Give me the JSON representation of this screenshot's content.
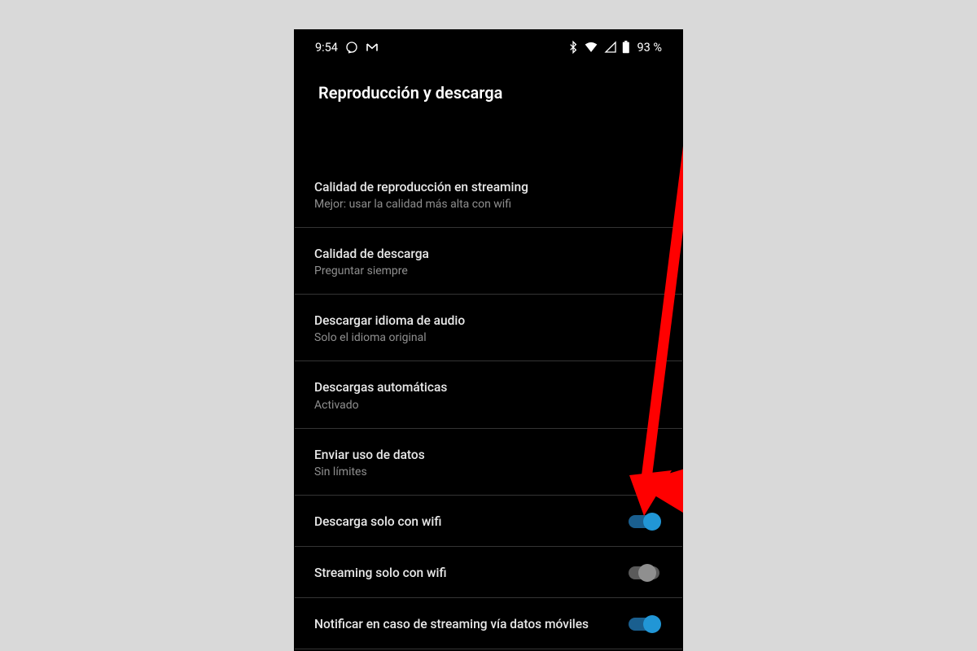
{
  "status": {
    "time": "9:54",
    "battery": "93 %",
    "icons_left": [
      "whatsapp-icon",
      "gmail-icon"
    ],
    "icons_right": [
      "bluetooth-icon",
      "wifi-icon",
      "cell-icon",
      "battery-icon"
    ]
  },
  "page": {
    "title": "Reproducción y descarga"
  },
  "settings": [
    {
      "title": "Calidad de reproducción en streaming",
      "sub": "Mejor: usar la calidad más alta con wifi",
      "type": "link"
    },
    {
      "title": "Calidad de descarga",
      "sub": "Preguntar siempre",
      "type": "link"
    },
    {
      "title": "Descargar idioma de audio",
      "sub": "Solo el idioma original",
      "type": "link"
    },
    {
      "title": "Descargas automáticas",
      "sub": "Activado",
      "type": "link"
    },
    {
      "title": "Enviar uso de datos",
      "sub": "Sin límites",
      "type": "link"
    },
    {
      "title": "Descarga solo con wifi",
      "type": "toggle",
      "value": true
    },
    {
      "title": "Streaming solo con wifi",
      "type": "toggle",
      "value": false
    },
    {
      "title": "Notificar en caso de streaming vía datos móviles",
      "type": "toggle",
      "value": true
    }
  ],
  "annotation": {
    "arrow_color": "#ff0000",
    "target_setting_index": 5
  }
}
